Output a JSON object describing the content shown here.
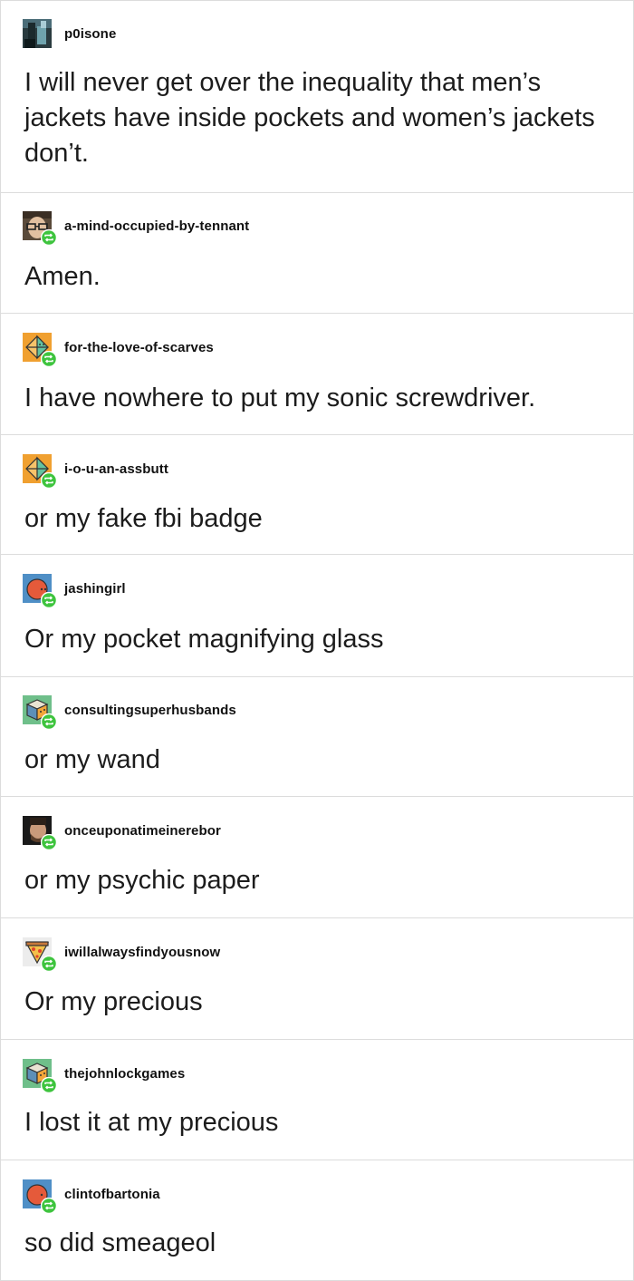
{
  "posts": [
    {
      "username": "p0isone",
      "text": "I will never get over the inequality that men’s jackets have inside pockets and women’s jackets don’t.",
      "avatar": "photo-avatar-dark",
      "reblog": false
    },
    {
      "username": "a-mind-occupied-by-tennant",
      "text": "Amen.",
      "avatar": "photo-avatar-glasses",
      "reblog": true
    },
    {
      "username": "for-the-love-of-scarves",
      "text": "I have nowhere to put my sonic screwdriver.",
      "avatar": "orange-octahedron-avatar",
      "reblog": true
    },
    {
      "username": "i-o-u-an-assbutt",
      "text": "or my fake fbi badge",
      "avatar": "orange-octahedron-avatar",
      "reblog": true
    },
    {
      "username": "jashingirl",
      "text": "Or my pocket magnifying glass",
      "avatar": "blue-circle-avatar",
      "reblog": true
    },
    {
      "username": "consultingsuperhusbands",
      "text": "or my wand",
      "avatar": "green-cube-avatar",
      "reblog": true
    },
    {
      "username": "onceuponatimeinerebor",
      "text": "or my psychic paper",
      "avatar": "photo-avatar-bearded",
      "reblog": true
    },
    {
      "username": "iwillalwaysfindyousnow",
      "text": "Or my precious",
      "avatar": "pizza-slice-avatar",
      "reblog": true
    },
    {
      "username": "thejohnlockgames",
      "text": "I lost it at my precious",
      "avatar": "green-cube-avatar",
      "reblog": true
    },
    {
      "username": "clintofbartonia",
      "text": "so did smeageol",
      "avatar": "blue-circle-avatar",
      "reblog": true
    }
  ],
  "colors": {
    "reblog_badge": "#3ec43e",
    "border": "#dcdcdc",
    "text": "#1c1c1c"
  }
}
